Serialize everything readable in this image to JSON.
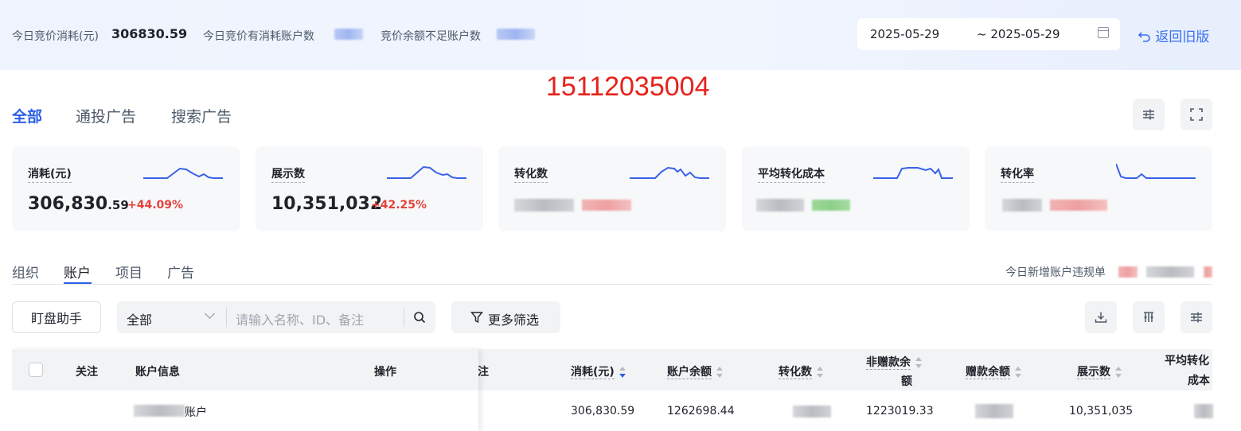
{
  "top": {
    "stat1_label": "今日竞价消耗(元)",
    "stat1_value": "306830.59",
    "stat2_label": "今日竞价有消耗账户数",
    "stat3_label": "竞价余额不足账户数",
    "date_start": "2025-05-29",
    "date_end": "~ 2025-05-29",
    "back_link": "返回旧版"
  },
  "overlay_number": "15112035004",
  "type_tabs": [
    "全部",
    "通投广告",
    "搜索广告"
  ],
  "metric_cards": [
    {
      "label": "消耗(元)",
      "value_main": "306,830",
      "value_dec": ".59",
      "delta": "+44.09%"
    },
    {
      "label": "展示数",
      "value_main": "10,351,032",
      "value_dec": "",
      "delta": "+42.25%"
    },
    {
      "label": "转化数"
    },
    {
      "label": "平均转化成本"
    },
    {
      "label": "转化率"
    }
  ],
  "level_tabs": [
    "组织",
    "账户",
    "项目",
    "广告"
  ],
  "violation_label": "今日新增账户违规单",
  "toolbar": {
    "watch_button": "盯盘助手",
    "scope_select": "全部",
    "search_placeholder": "请输入名称、ID、备注",
    "filter_button": "更多筛选"
  },
  "table": {
    "headers": {
      "follow": "关注",
      "account_info": "账户信息",
      "action": "操作",
      "note_partial": "注",
      "cost": "消耗(元)",
      "balance": "账户余额",
      "conversions": "转化数",
      "non_gift_balance_1": "非赠款余",
      "non_gift_balance_2": "额",
      "gift_balance": "赠款余额",
      "impressions": "展示数",
      "avg_cost_1": "平均转化",
      "avg_cost_2": "成本"
    },
    "row": {
      "account_name_suffix": "账户",
      "cost": "306,830.59",
      "balance": "1262698.44",
      "non_gift_balance": "1223019.33",
      "impressions": "10,351,035"
    }
  },
  "colors": {
    "accent": "#2b5fe6",
    "up": "#e5423b",
    "overlay": "#e5231b"
  }
}
